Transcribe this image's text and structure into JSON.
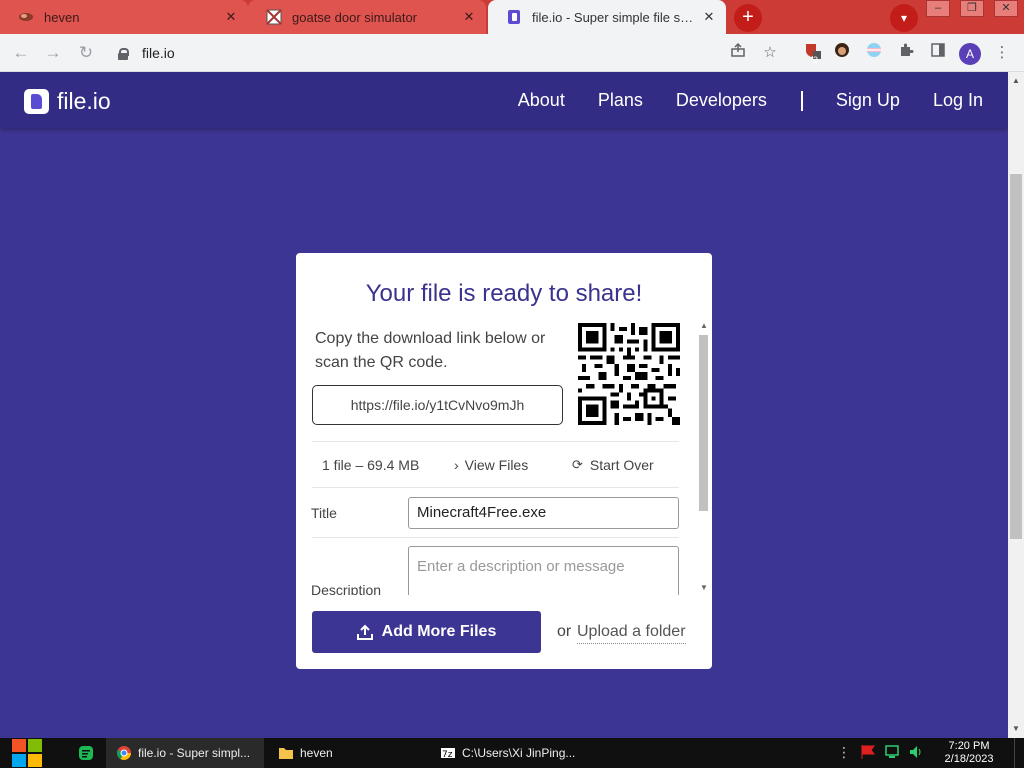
{
  "browser": {
    "tabs": [
      {
        "title": "heven",
        "active": false
      },
      {
        "title": "goatse door simulator",
        "active": false
      },
      {
        "title": "file.io - Super simple file sharing",
        "active": true
      }
    ],
    "new_tab_label": "+",
    "url": "file.io",
    "profile_initial": "A",
    "extension_badge": "2"
  },
  "site": {
    "logo_text": "file.io",
    "nav": {
      "about": "About",
      "plans": "Plans",
      "developers": "Developers",
      "sign_up": "Sign Up",
      "log_in": "Log In"
    }
  },
  "card": {
    "title": "Your file is ready to share!",
    "instructions": "Copy the download link below or scan the QR code.",
    "link": "https://file.io/y1tCvNvo9mJh",
    "file_summary": "1 file – 69.4 MB",
    "view_files": "View Files",
    "start_over": "Start Over",
    "title_label": "Title",
    "title_value": "Minecraft4Free.exe",
    "description_label": "Description",
    "description_placeholder": "Enter a description or message",
    "add_more_files": "Add More Files",
    "or_text": "or",
    "upload_folder": "Upload a folder"
  },
  "taskbar": {
    "apps": [
      {
        "label": "file.io - Super simpl...",
        "active": true
      },
      {
        "label": "heven",
        "active": false
      },
      {
        "label": "C:\\Users\\Xi JinPing...",
        "active": false
      }
    ],
    "time": "7:20 PM",
    "date": "2/18/2023"
  },
  "colors": {
    "page_bg": "#3d3593",
    "nav_bg": "#322c85",
    "tabstrip": "#cc3b35",
    "accent": "#3a338e"
  },
  "icons": [
    "lock-icon",
    "qr-code",
    "share-icon",
    "star-icon",
    "extensions-icon",
    "upload-icon",
    "chevron-right-icon",
    "refresh-icon",
    "windows-logo",
    "chrome-icon",
    "folder-icon"
  ]
}
